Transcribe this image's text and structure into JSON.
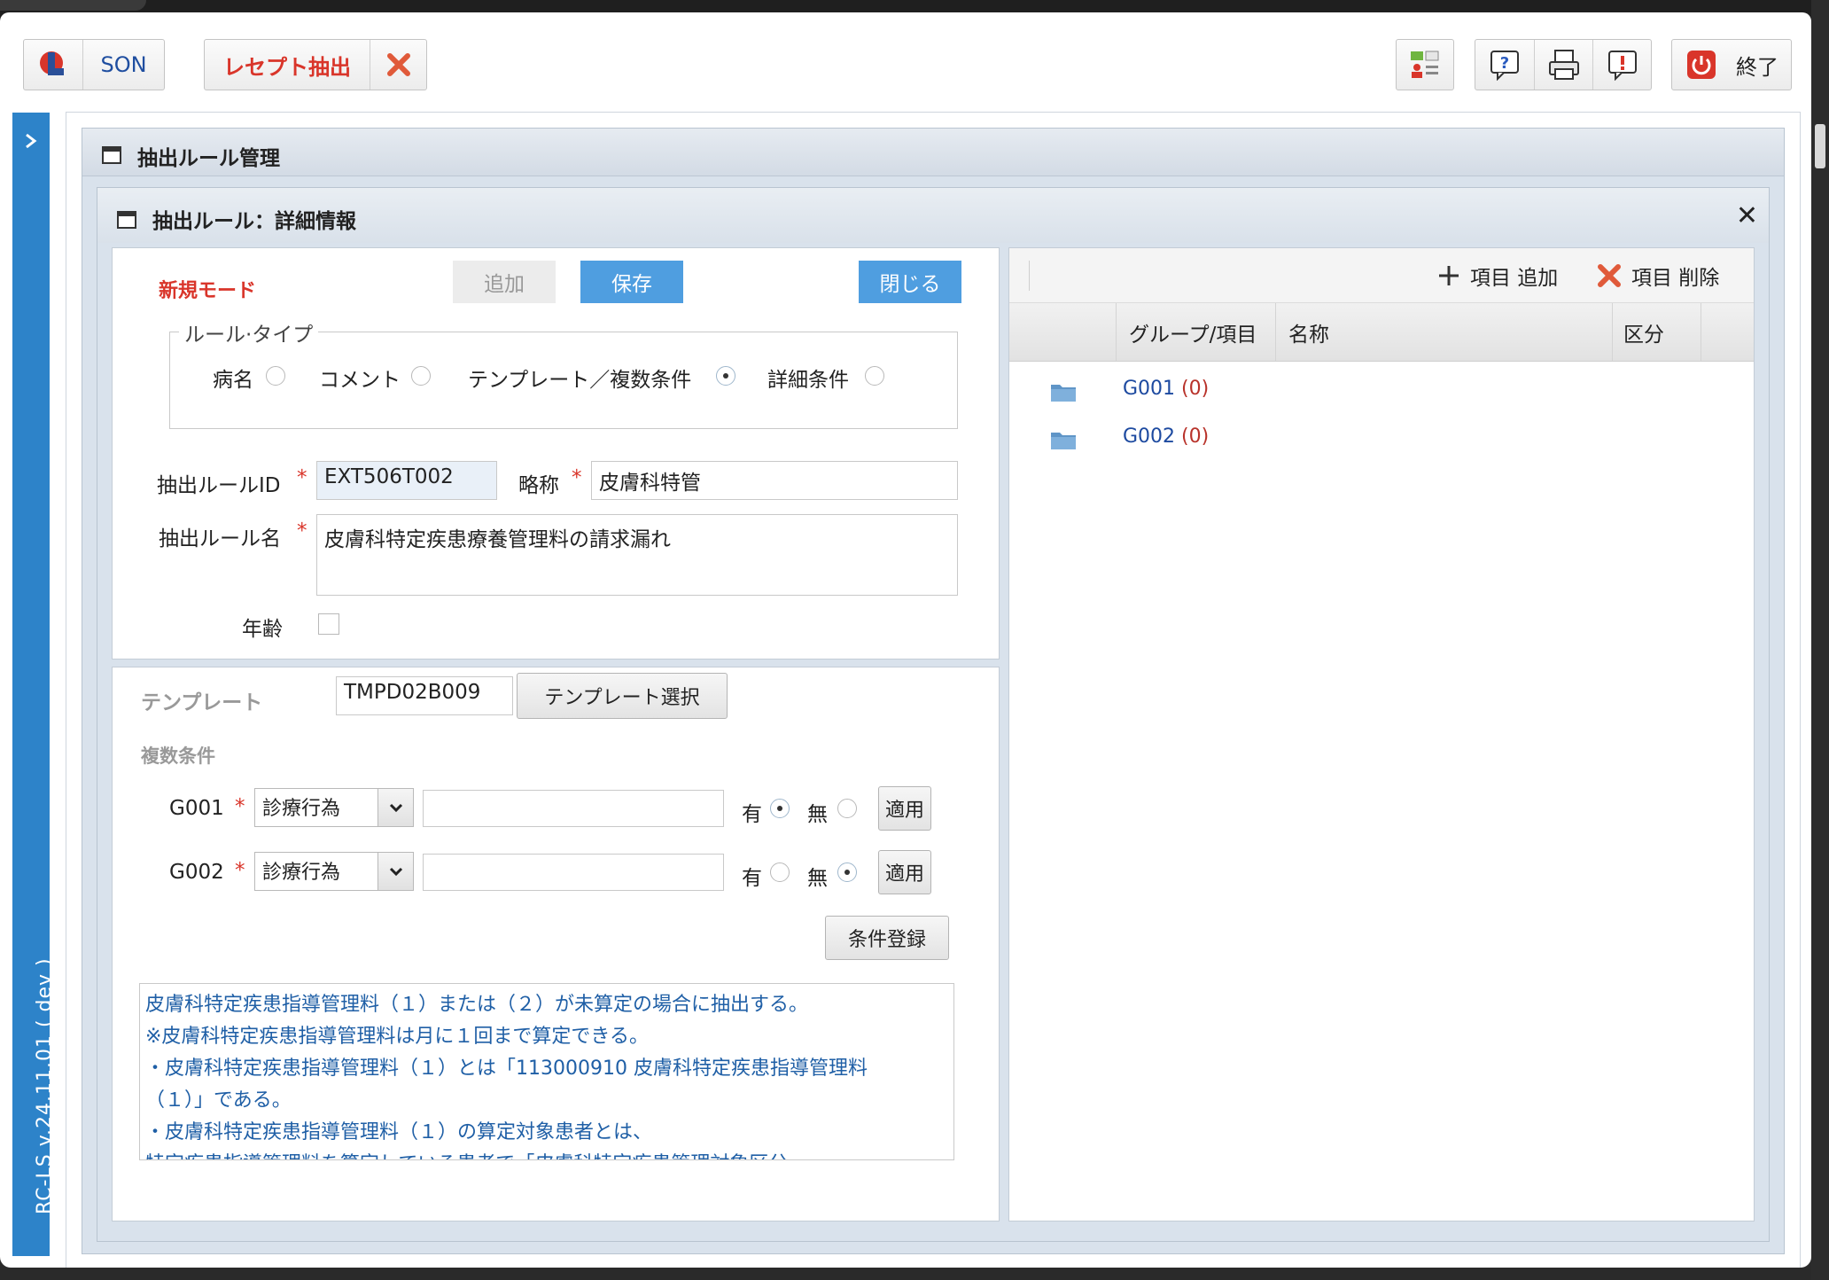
{
  "toolbar": {
    "app_label": "SON",
    "receipt_extract_label": "レセプト抽出",
    "exit_label": "終了"
  },
  "sidebar": {
    "version": "RC-LS v.24.11.01 ( dev )"
  },
  "outer_panel": {
    "title": "抽出ルール管理"
  },
  "dialog": {
    "title": "抽出ルール：詳細情報",
    "mode_label": "新規モード",
    "buttons": {
      "add": "追加",
      "save": "保存",
      "close": "閉じる"
    },
    "rule_type": {
      "legend": "ルール·タイプ",
      "options": [
        {
          "label": "病名",
          "selected": false
        },
        {
          "label": "コメント",
          "selected": false
        },
        {
          "label": "テンプレート／複数条件",
          "selected": true
        },
        {
          "label": "詳細条件",
          "selected": false
        }
      ]
    },
    "fields": {
      "rule_id_label": "抽出ルールID",
      "rule_id_value": "EXT506T002",
      "abbr_label": "略称",
      "abbr_value": "皮膚科特管",
      "rule_name_label": "抽出ルール名",
      "rule_name_value": "皮膚科特定疾患療養管理料の請求漏れ",
      "age_label": "年齢",
      "required_mark": "*"
    },
    "template": {
      "label": "テンプレート",
      "value": "TMPD02B009",
      "select_button": "テンプレート選択"
    },
    "conditions": {
      "label": "複数条件",
      "rows": [
        {
          "group": "G001",
          "type": "診療行為",
          "value": "",
          "yes_label": "有",
          "no_label": "無",
          "selected": "yes",
          "apply_label": "適用"
        },
        {
          "group": "G002",
          "type": "診療行為",
          "value": "",
          "yes_label": "有",
          "no_label": "無",
          "selected": "no",
          "apply_label": "適用"
        }
      ],
      "register_button": "条件登録"
    },
    "description_lines": [
      "皮膚科特定疾患指導管理料（１）または（２）が未算定の場合に抽出する。",
      "※皮膚科特定疾患指導管理料は月に１回まで算定できる。",
      "・皮膚科特定疾患指導管理料（１）とは「113000910 皮膚科特定疾患指導管理料",
      "（１）」である。",
      "・皮膚科特定疾患指導管理料（１）の算定対象患者とは、",
      "特定疾患指導管理料を算定している患者で「皮膚科特定疾患管理対象区分"
    ]
  },
  "right_panel": {
    "add_item": "項目 追加",
    "delete_item": "項目 削除",
    "columns": [
      "グループ/項目",
      "名称",
      "区分"
    ],
    "groups": [
      {
        "id": "G001",
        "count": "(0)"
      },
      {
        "id": "G002",
        "count": "(0)"
      }
    ]
  },
  "colors": {
    "accent_blue": "#4f9ee0",
    "sidebar_blue": "#2d83c9",
    "required_red": "#d9352a",
    "link_blue": "#1d4aa0",
    "count_red": "#b8322a",
    "description_blue": "#1f5fa6"
  }
}
